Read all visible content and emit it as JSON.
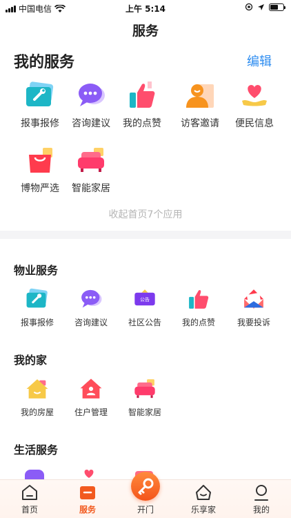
{
  "status_bar": {
    "carrier": "中国电信",
    "time": "上午 5:14"
  },
  "nav": {
    "title": "服务"
  },
  "my_services": {
    "title": "我的服务",
    "edit_label": "编辑",
    "items": [
      {
        "label": "报事报修",
        "icon": "repair-card-icon"
      },
      {
        "label": "咨询建议",
        "icon": "chat-bubble-icon"
      },
      {
        "label": "我的点赞",
        "icon": "thumbs-up-icon"
      },
      {
        "label": "访客邀请",
        "icon": "visitor-icon"
      },
      {
        "label": "便民信息",
        "icon": "heart-hand-icon"
      },
      {
        "label": "博物严选",
        "icon": "shopping-bag-icon"
      },
      {
        "label": "智能家居",
        "icon": "sofa-icon"
      }
    ],
    "collapse_label": "收起首页7个应用"
  },
  "property_services": {
    "title": "物业服务",
    "items": [
      {
        "label": "报事报修",
        "icon": "repair-card-icon"
      },
      {
        "label": "咨询建议",
        "icon": "chat-bubble-icon"
      },
      {
        "label": "社区公告",
        "icon": "notice-board-icon",
        "badge": "公告"
      },
      {
        "label": "我的点赞",
        "icon": "thumbs-up-icon"
      },
      {
        "label": "我要投诉",
        "icon": "complaint-envelope-icon"
      }
    ]
  },
  "my_home": {
    "title": "我的家",
    "items": [
      {
        "label": "我的房屋",
        "icon": "house-icon"
      },
      {
        "label": "住户管理",
        "icon": "resident-house-icon"
      },
      {
        "label": "智能家居",
        "icon": "sofa-icon"
      }
    ]
  },
  "life_services": {
    "title": "生活服务"
  },
  "tab_bar": {
    "items": [
      {
        "label": "首页",
        "icon": "home-icon"
      },
      {
        "label": "服务",
        "icon": "service-icon",
        "active": true
      },
      {
        "label": "开门",
        "icon": "key-icon"
      },
      {
        "label": "乐享家",
        "icon": "smile-house-icon"
      },
      {
        "label": "我的",
        "icon": "profile-icon"
      }
    ]
  },
  "colors": {
    "accent": "#f25a1f",
    "link": "#2d8cf0",
    "muted": "#b5b5b5"
  }
}
